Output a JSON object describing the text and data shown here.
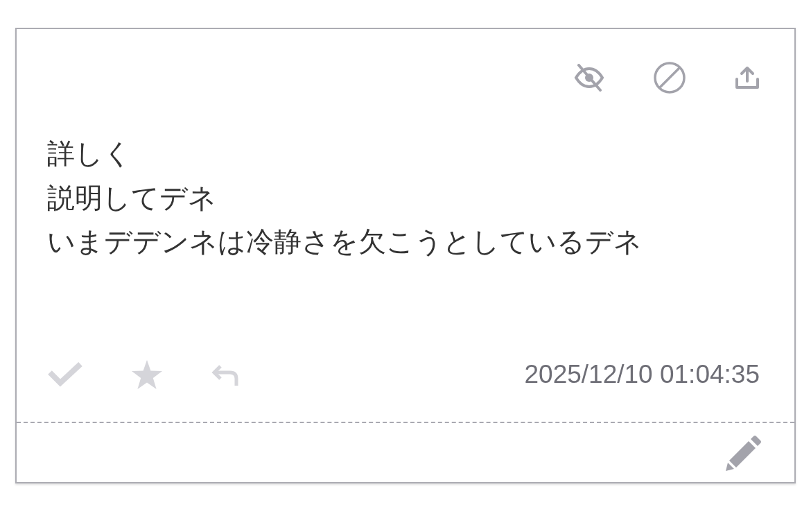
{
  "message": {
    "lines": [
      "詳しく",
      "説明してデネ",
      "いまデデンネは冷静さを欠こうとしているデネ"
    ],
    "timestamp": "2025/12/10 01:04:35"
  }
}
